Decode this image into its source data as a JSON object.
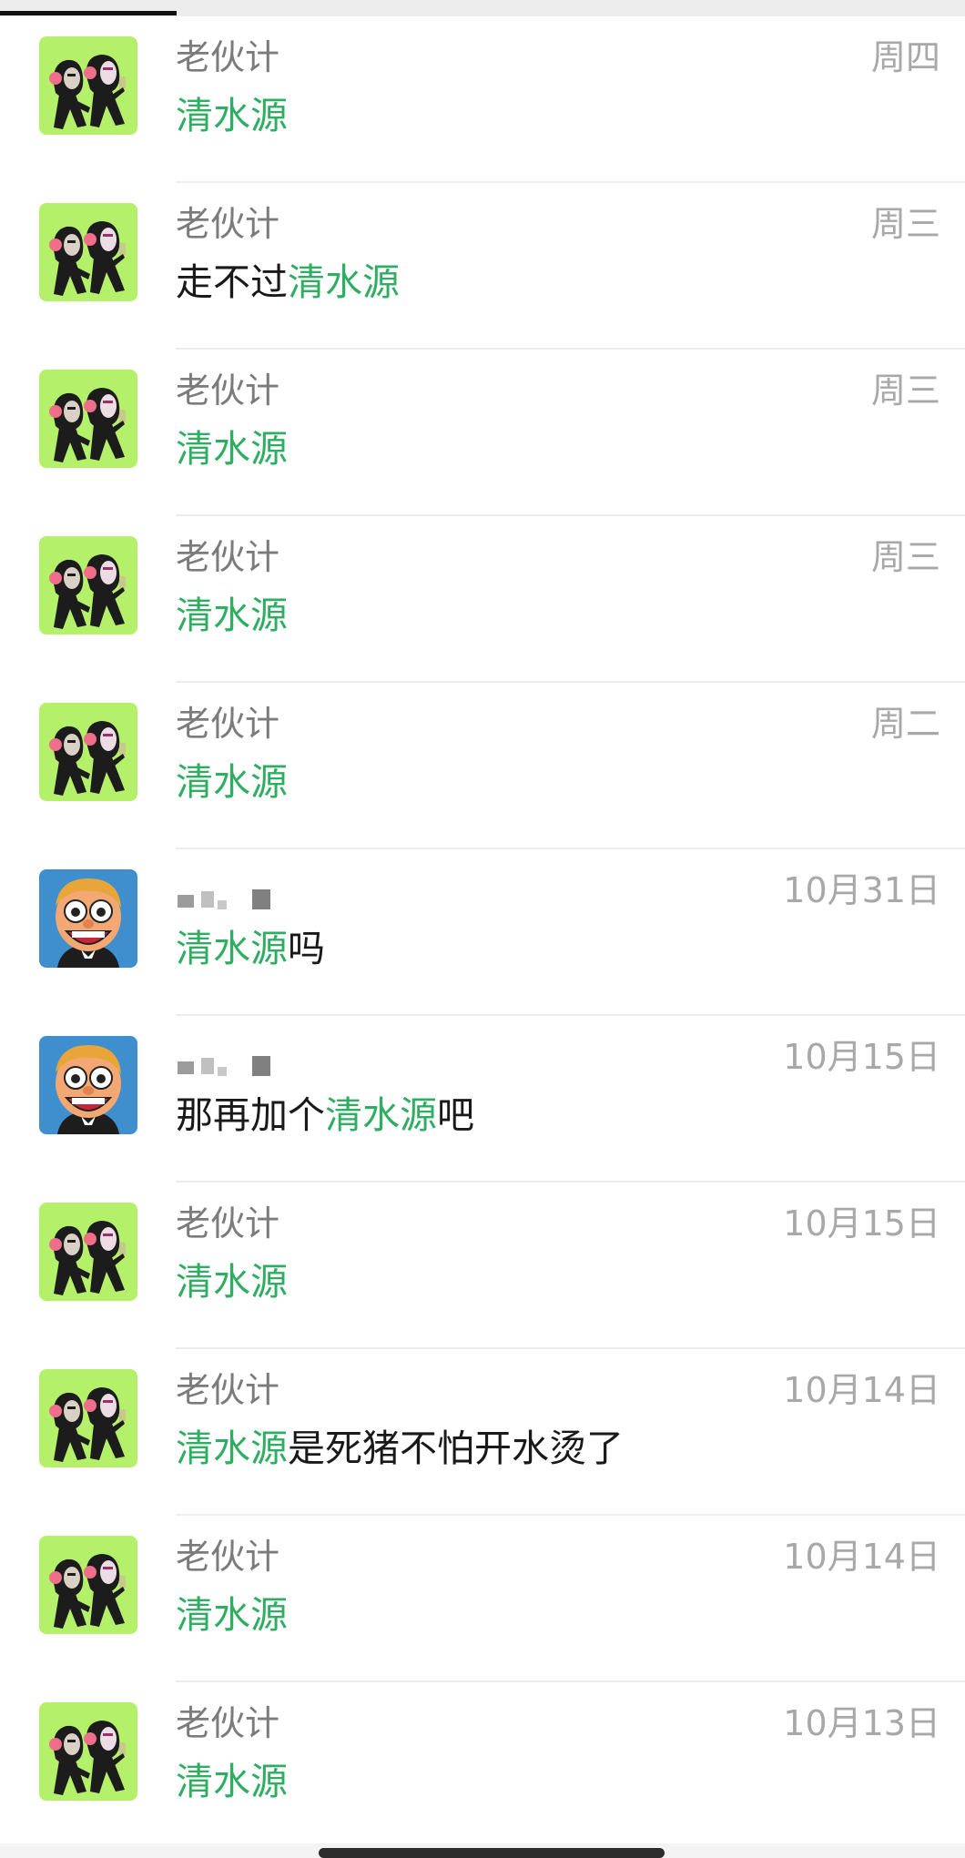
{
  "colors": {
    "highlight": "#2fae62",
    "sender": "#7b7b7b",
    "date": "#a8a8a8",
    "message": "#191919"
  },
  "icons": {
    "avatar_group": "cartoon-group-avatar-icon",
    "avatar_person": "cartoon-face-avatar-icon"
  },
  "results": [
    {
      "sender": "老伙计",
      "date": "周四",
      "avatar": "group",
      "pre": "",
      "hl": "清水源",
      "post": ""
    },
    {
      "sender": "老伙计",
      "date": "周三",
      "avatar": "group",
      "pre": "走不过",
      "hl": "清水源",
      "post": ""
    },
    {
      "sender": "老伙计",
      "date": "周三",
      "avatar": "group",
      "pre": "",
      "hl": "清水源",
      "post": ""
    },
    {
      "sender": "老伙计",
      "date": "周三",
      "avatar": "group",
      "pre": "",
      "hl": "清水源",
      "post": ""
    },
    {
      "sender": "老伙计",
      "date": "周二",
      "avatar": "group",
      "pre": "",
      "hl": "清水源",
      "post": ""
    },
    {
      "sender": "",
      "date": "10月31日",
      "avatar": "person",
      "pre": "",
      "hl": "清水源",
      "post": "吗"
    },
    {
      "sender": "",
      "date": "10月15日",
      "avatar": "person",
      "pre": "那再加个",
      "hl": "清水源",
      "post": "吧"
    },
    {
      "sender": "老伙计",
      "date": "10月15日",
      "avatar": "group",
      "pre": "",
      "hl": "清水源",
      "post": ""
    },
    {
      "sender": "老伙计",
      "date": "10月14日",
      "avatar": "group",
      "pre": "",
      "hl": "清水源",
      "post": "是死猪不怕开水烫了"
    },
    {
      "sender": "老伙计",
      "date": "10月14日",
      "avatar": "group",
      "pre": "",
      "hl": "清水源",
      "post": ""
    },
    {
      "sender": "老伙计",
      "date": "10月13日",
      "avatar": "group",
      "pre": "",
      "hl": "清水源",
      "post": ""
    }
  ]
}
